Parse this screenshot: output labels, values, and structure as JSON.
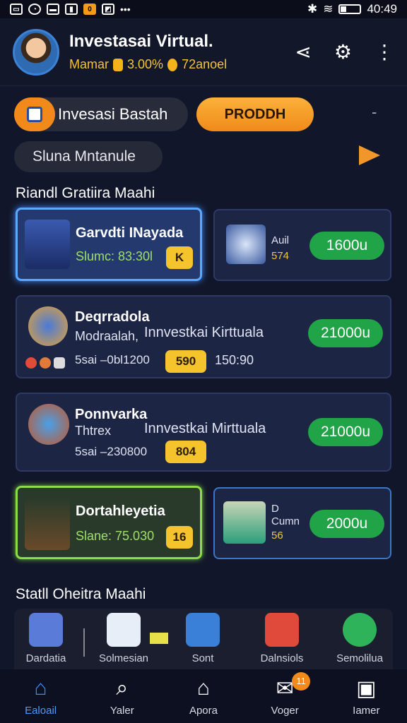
{
  "status_bar": {
    "time": "40:49",
    "left_icons": [
      "sd-card-icon",
      "whatsapp-icon",
      "message-icon",
      "signal-icon",
      "app-badge-icon",
      "image-icon",
      "more-dots-icon"
    ],
    "app_badge": "0"
  },
  "header": {
    "title": "Investasai Virtual.",
    "subtitle_a": "Mamar",
    "subtitle_b": "3.00%",
    "subtitle_c": "72anoel"
  },
  "row1": {
    "dark_pill_label": "Invesasi Bastah",
    "orange_pill_label": "PRODDH",
    "dash": "-"
  },
  "row2": {
    "gray_pill_label": "Sluna Mntanule"
  },
  "section1": {
    "title": "Riandl Gratiira Maahi"
  },
  "cards": {
    "c1": {
      "title": "Garvdti INayada",
      "line": "Slumc: 83:30l",
      "badge": "K"
    },
    "c2": {
      "small_a": "Auil",
      "small_b": "574",
      "button": "1600u"
    },
    "c3": {
      "title": "Deqrradola",
      "line_a": "Modraalah,",
      "line_b": "Innvestkai Kirttuala",
      "line_c": "5sai  –0bl1200",
      "badge": "590",
      "extra": "150:90",
      "button": "21000u"
    },
    "c4": {
      "title": "Ponnvarka",
      "line_a": "Thtrex",
      "line_b": "Innvestkai Mirttuala",
      "line_c": "5sai  –230800",
      "badge": "804",
      "button": "21000u"
    },
    "c5": {
      "title": "Dortahleyetia",
      "line": "Slane: 75.030",
      "badge": "16"
    },
    "c6": {
      "small_a": "D",
      "small_b": "Cumn",
      "small_c": "56",
      "button": "2000u"
    }
  },
  "section2": {
    "title": "Statll Oheitra Maahi"
  },
  "bottom_grid": [
    {
      "label": "Dardatia",
      "icon": "treasure-box-icon",
      "color": "#5b7bd8"
    },
    {
      "label": "Solmesian",
      "icon": "document-icon",
      "color": "#e8eef8"
    },
    {
      "label": "Sont",
      "icon": "chart-icon",
      "color": "#3a7fd8"
    },
    {
      "label": "Dalnsiols",
      "icon": "gift-icon",
      "color": "#e04a3a"
    },
    {
      "label": "Semolilua",
      "icon": "chat-bot-icon",
      "color": "#2fb35a"
    }
  ],
  "nav": [
    {
      "label": "Ealoail",
      "icon": "home-icon"
    },
    {
      "label": "Yaler",
      "icon": "search-icon"
    },
    {
      "label": "Apora",
      "icon": "house-icon"
    },
    {
      "label": "Voger",
      "icon": "mail-icon",
      "badge": "11"
    },
    {
      "label": "Iamer",
      "icon": "gallery-icon"
    }
  ],
  "colors": {
    "accent_orange": "#f28a1b",
    "accent_green": "#21a347",
    "accent_blue": "#3b8bff",
    "badge_yellow": "#f5c32b"
  }
}
